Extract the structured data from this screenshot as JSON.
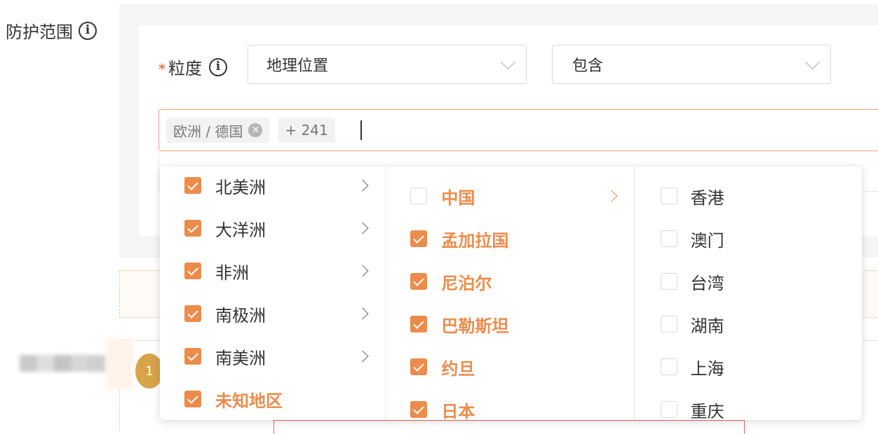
{
  "form": {
    "scope_label": "防护范围",
    "granularity_label": "粒度",
    "required_mark": "*",
    "granularity_select": {
      "value": "地理位置"
    },
    "match_select": {
      "value": "包含"
    },
    "tags": {
      "selected_tag": "欧洲 / 德国",
      "overflow_count": "+ 241"
    }
  },
  "dropdown": {
    "level1": [
      {
        "label": "北美洲",
        "checked": true,
        "has_children": true,
        "active": false
      },
      {
        "label": "大洋洲",
        "checked": true,
        "has_children": true,
        "active": false
      },
      {
        "label": "非洲",
        "checked": true,
        "has_children": true,
        "active": false
      },
      {
        "label": "南极洲",
        "checked": true,
        "has_children": true,
        "active": false
      },
      {
        "label": "南美洲",
        "checked": true,
        "has_children": true,
        "active": false
      },
      {
        "label": "未知地区",
        "checked": true,
        "has_children": false,
        "active": true
      }
    ],
    "level2": [
      {
        "label": "中国",
        "checked": false,
        "has_children": true,
        "active": true
      },
      {
        "label": "孟加拉国",
        "checked": true,
        "has_children": false,
        "active": true
      },
      {
        "label": "尼泊尔",
        "checked": true,
        "has_children": false,
        "active": true
      },
      {
        "label": "巴勒斯坦",
        "checked": true,
        "has_children": false,
        "active": true
      },
      {
        "label": "约旦",
        "checked": true,
        "has_children": false,
        "active": true
      },
      {
        "label": "日本",
        "checked": true,
        "has_children": false,
        "active": true
      }
    ],
    "level3": [
      {
        "label": "香港",
        "checked": false
      },
      {
        "label": "澳门",
        "checked": false
      },
      {
        "label": "台湾",
        "checked": false
      },
      {
        "label": "湖南",
        "checked": false
      },
      {
        "label": "上海",
        "checked": false
      },
      {
        "label": "重庆",
        "checked": false
      }
    ]
  },
  "step_badge": "1",
  "colors": {
    "accent": "#ec8c4c",
    "required": "#e5542f",
    "badge": "#d9a34a"
  },
  "icons": {
    "info": "info-circle-icon",
    "chevron": "chevron-down-icon",
    "close": "close-circle-icon",
    "arrow": "chevron-right-icon"
  }
}
